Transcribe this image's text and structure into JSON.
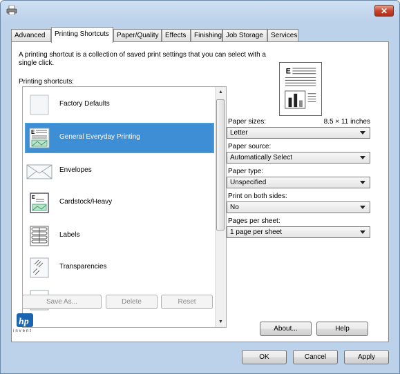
{
  "window": {
    "close_glyph": "✕"
  },
  "tabs": [
    {
      "label": "Advanced"
    },
    {
      "label": "Printing Shortcuts"
    },
    {
      "label": "Paper/Quality"
    },
    {
      "label": "Effects"
    },
    {
      "label": "Finishing"
    },
    {
      "label": "Job Storage"
    },
    {
      "label": "Services"
    }
  ],
  "active_tab": "Printing Shortcuts",
  "panel": {
    "description": "A printing shortcut is a collection of saved print settings that you can select with a single click.",
    "shortcuts_label": "Printing shortcuts:",
    "shortcuts": [
      {
        "label": "Factory Defaults",
        "icon": "blank-page-icon"
      },
      {
        "label": "General Everyday Printing",
        "icon": "general-document-icon",
        "selected": true
      },
      {
        "label": "Envelopes",
        "icon": "envelope-icon"
      },
      {
        "label": "Cardstock/Heavy",
        "icon": "cardstock-icon"
      },
      {
        "label": "Labels",
        "icon": "labels-icon"
      },
      {
        "label": "Transparencies",
        "icon": "transparency-icon"
      }
    ],
    "buttons": {
      "save_as": "Save As...",
      "delete": "Delete",
      "reset": "Reset",
      "about": "About...",
      "help": "Help"
    },
    "settings": {
      "paper_sizes_label": "Paper sizes:",
      "paper_size_dimensions": "8.5 × 11 inches",
      "paper_size_value": "Letter",
      "paper_source_label": "Paper source:",
      "paper_source_value": "Automatically Select",
      "paper_type_label": "Paper type:",
      "paper_type_value": "Unspecified",
      "print_both_sides_label": "Print on both sides:",
      "print_both_sides_value": "No",
      "pages_per_sheet_label": "Pages per sheet:",
      "pages_per_sheet_value": "1 page per sheet"
    },
    "logo_text": "invent"
  },
  "footer": {
    "ok": "OK",
    "cancel": "Cancel",
    "apply": "Apply"
  },
  "colors": {
    "selection": "#3d8ed4",
    "selection_border": "#4a9bd6",
    "close_button": "#c7452b",
    "hp_blue": "#1b64b0"
  }
}
